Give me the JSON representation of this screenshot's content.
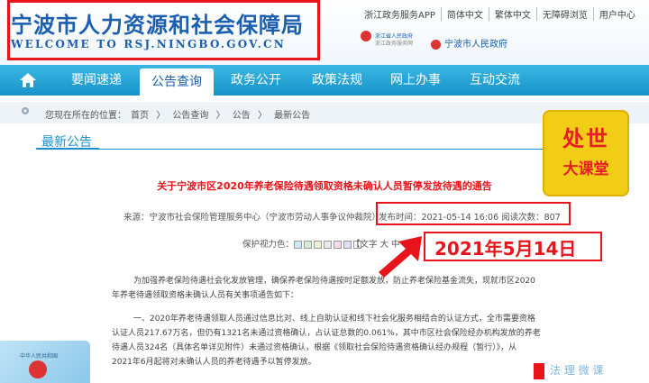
{
  "header": {
    "site_title": "宁波市人力资源和社会保障局",
    "site_subtitle": "WELCOME TO RSJ.NINGBO.GOV.CN",
    "top_links": [
      "浙江政务服务APP",
      "简体中文",
      "繁体中文",
      "无障碍浏览",
      "用户中心"
    ],
    "gov_portal_a_line1": "浙江省人民政府",
    "gov_portal_a_line2": "浙江政务服务网",
    "gov_portal_b": "宁波市人民政府"
  },
  "nav": {
    "items": [
      "要闻速递",
      "公告查询",
      "政务公开",
      "政策法规",
      "网上办事",
      "互动交流"
    ],
    "active_index": 1
  },
  "breadcrumb": {
    "label": "您现在所在的位置：",
    "trail": [
      "首页",
      "〉",
      "公告查询",
      "〉",
      "公告",
      "〉",
      "最新公告"
    ]
  },
  "section": {
    "title": "最新公告"
  },
  "badge": {
    "line1": "处世",
    "line2": "大课堂"
  },
  "article": {
    "title": "关于宁波市区2020年养老保险待遇领取资格未确认人员暂停发放待遇的通告",
    "source": "来源：宁波市社会保险管理服务中心（宁波市劳动人事争议仲裁院）",
    "publish_info": "发布时间：2021-05-14 16:06 阅读次数：807",
    "eye_label": "保护视力色：",
    "font_label": "【文字 大 中 小】",
    "annotation_date": "2021年5月14日",
    "swatch_colors": [
      "#c9e8f6",
      "#d8ecd0",
      "#f0f0d0",
      "#e9e9e9",
      "#f4dce8",
      "#e0dcf4",
      "#ffffff"
    ],
    "para1_lines": [
      "为加强养老保险待遇社会化发放管理，确保养老保险待遇按时足额发放，防止养老保险基金流失，现就市区2020",
      "年养老待遇领取资格未确认人员有关事项通告如下："
    ],
    "para2_lines": [
      "一、2020年养老待遇领取人员通过信息比对、线上自助认证和线下社会化服务相结合的认证方式，全市需要资格",
      "认证人员217.67万名，但仍有1321名未通过资格确认，占认证总数的0.061%，其中市区社会保险经办机构发放的养老",
      "待遇人员324名（具体名单详见附件）未通过资格确认，根据《领取社会保险待遇资格确认经办规程（暂行）》，从",
      "2021年6月起将对未确认人员的养老待遇予以暂停发放。"
    ]
  },
  "footer_card": {
    "text": "中华人民共和国"
  },
  "watermark": {
    "text": "法 理 微 课"
  },
  "colors": {
    "brand_blue": "#1b5fae",
    "nav_blue": "#1692c8",
    "highlight_red": "#e8141b",
    "badge_yellow": "#f2cd17"
  }
}
